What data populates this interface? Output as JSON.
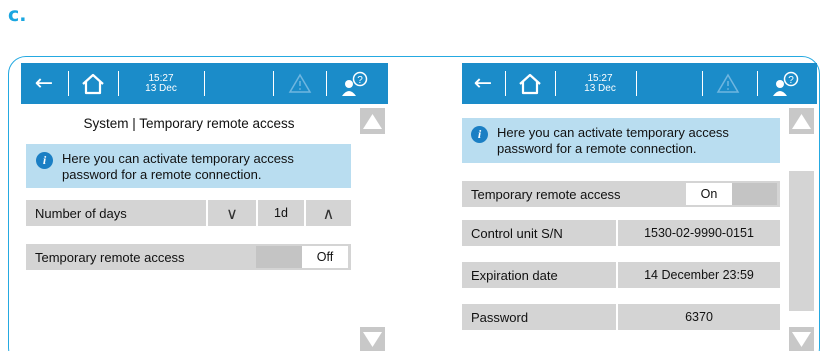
{
  "figure": {
    "label": "c."
  },
  "topbar": {
    "time": "15:27",
    "date": "13 Dec",
    "back_icon": "arrow-left-icon",
    "home_icon": "home-icon",
    "warning_icon": "warning-triangle-icon",
    "help_icon": "user-help-icon",
    "bar_color": "#1b8cc9"
  },
  "left_screen": {
    "title": "System | Temporary remote access",
    "info_text_line1": "Here you can activate temporary access",
    "info_text_line2": "password for a remote connection.",
    "number_of_days": {
      "label": "Number of days",
      "value": "1d",
      "decrease_icon": "chevron-down-icon",
      "increase_icon": "chevron-up-icon"
    },
    "remote_access": {
      "label": "Temporary remote access",
      "state": "Off"
    }
  },
  "right_screen": {
    "info_text_line1": "Here you can activate temporary access",
    "info_text_line2": "password for a remote connection.",
    "remote_access": {
      "label": "Temporary remote access",
      "state": "On"
    },
    "control_unit": {
      "label": "Control unit S/N",
      "value": "1530-02-9990-0151"
    },
    "expiration": {
      "label": "Expiration date",
      "value": "14 December 23:59"
    },
    "password": {
      "label": "Password",
      "value": "6370"
    }
  },
  "colors": {
    "accent": "#1b8cc9",
    "info_background": "#b9ddf0",
    "row_background": "#d4d4d4",
    "frame_border": "#25a9e1"
  }
}
